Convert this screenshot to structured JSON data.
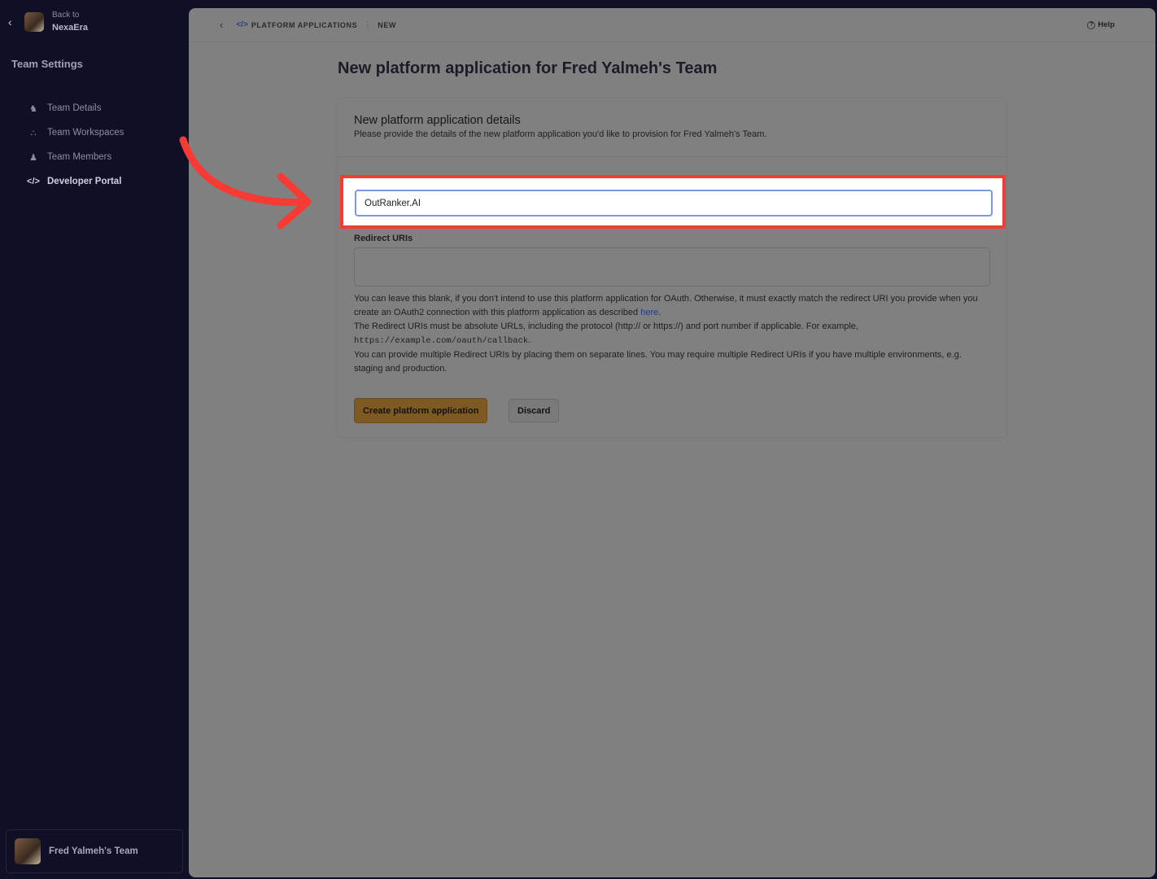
{
  "sidebar": {
    "back_small": "Back to",
    "back_name": "NexaEra",
    "title": "Team Settings",
    "items": [
      {
        "label": "Team Details",
        "icon": "users-icon"
      },
      {
        "label": "Team Workspaces",
        "icon": "workspaces-icon"
      },
      {
        "label": "Team Members",
        "icon": "members-icon"
      },
      {
        "label": "Developer Portal",
        "icon": "code-icon",
        "active": true
      }
    ],
    "team_name": "Fred Yalmeh's Team"
  },
  "topbar": {
    "crumb_1": "PLATFORM APPLICATIONS",
    "crumb_2": "NEW",
    "help": "Help"
  },
  "page": {
    "title": "New platform application for Fred Yalmeh's Team"
  },
  "card": {
    "title": "New platform application details",
    "subtitle": "Please provide the details of the new platform application you'd like to provision for Fred Yalmeh's Team.",
    "name_value": "OutRanker.AI",
    "redirect_label": "Redirect URIs",
    "help_line1": "You can leave this blank, if you don't intend to use this platform application for OAuth. Otherwise, it must exactly match the redirect URI you provide when you create an OAuth2 connection with this platform application as described",
    "help_link": "here",
    "help_line2": "The Redirect URIs must be absolute URLs, including the protocol (http:// or https://) and port number if applicable. For example,",
    "help_example": "https://example.com/oauth/callback",
    "help_line3": "You can provide multiple Redirect URIs by placing them on separate lines. You may require multiple Redirect URIs if you have multiple environments, e.g. staging and production.",
    "create_label": "Create platform application",
    "discard_label": "Discard"
  },
  "colors": {
    "highlight": "#f83a34",
    "sidebar_bg": "#0f0f26",
    "primary_button": "#7d5a22"
  }
}
